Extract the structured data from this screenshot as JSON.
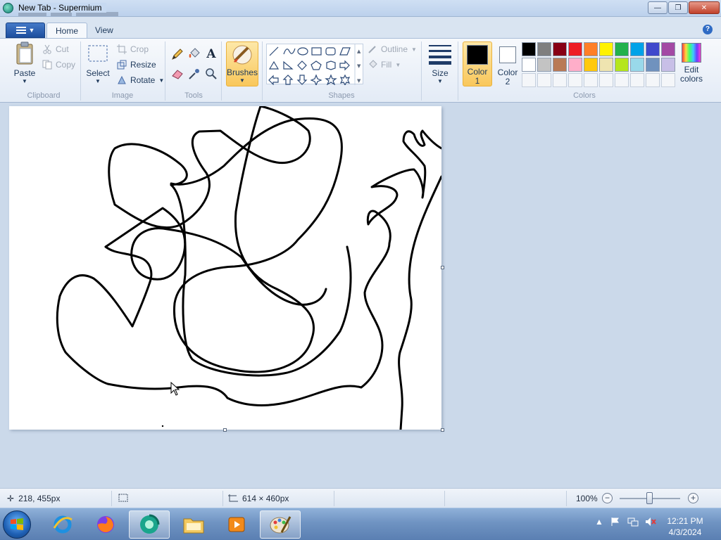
{
  "window": {
    "title": "New Tab - Supermium",
    "buttons": {
      "minimize": "—",
      "maximize": "❐",
      "close": "✕"
    }
  },
  "ribbon": {
    "tabs": [
      {
        "label": "Home",
        "active": true
      },
      {
        "label": "View",
        "active": false
      }
    ],
    "help": "?",
    "clipboard": {
      "label": "Clipboard",
      "paste": "Paste",
      "cut": "Cut",
      "copy": "Copy"
    },
    "image": {
      "label": "Image",
      "select": "Select",
      "crop": "Crop",
      "resize": "Resize",
      "rotate": "Rotate"
    },
    "tools": {
      "label": "Tools",
      "text_glyph": "A"
    },
    "brushes": {
      "label": "Brushes"
    },
    "shapes": {
      "label": "Shapes",
      "outline": "Outline",
      "fill": "Fill"
    },
    "size": {
      "label": "Size"
    },
    "colors": {
      "label": "Colors",
      "color1": {
        "label": "Color",
        "num": "1",
        "value": "#000000"
      },
      "color2": {
        "label": "Color",
        "num": "2",
        "value": "#ffffff"
      },
      "edit": {
        "line1": "Edit",
        "line2": "colors"
      },
      "palette": [
        "#000000",
        "#7f7f7f",
        "#880015",
        "#ed1c24",
        "#ff7f27",
        "#fff200",
        "#22b14c",
        "#00a2e8",
        "#3f48cc",
        "#a349a4",
        "#ffffff",
        "#c3c3c3",
        "#b97a57",
        "#ffaec9",
        "#ffc90e",
        "#efe4b0",
        "#b5e61d",
        "#99d9ea",
        "#7092be",
        "#c8bfe7",
        "",
        "",
        "",
        "",
        "",
        "",
        "",
        "",
        "",
        ""
      ]
    }
  },
  "status": {
    "cursor_pos": "218, 455px",
    "canvas_size": "614 × 460px",
    "zoom": "100%"
  },
  "taskbar": {
    "items": [
      {
        "name": "ie-icon",
        "active": false
      },
      {
        "name": "firefox-icon",
        "active": false
      },
      {
        "name": "supermium-icon",
        "active": true
      },
      {
        "name": "file-explorer-icon",
        "active": false
      },
      {
        "name": "media-player-icon",
        "active": false
      },
      {
        "name": "paint-icon",
        "active": true
      }
    ],
    "time": "12:21 PM",
    "date": "4/3/2024"
  }
}
